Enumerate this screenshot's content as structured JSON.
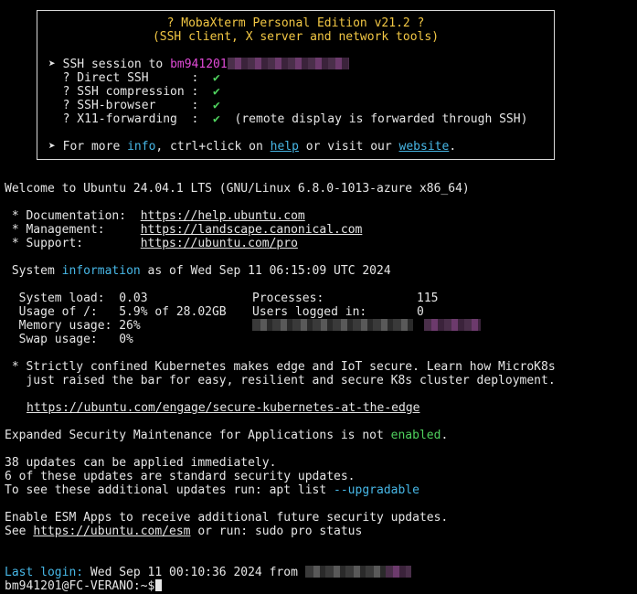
{
  "banner": {
    "title": "? MobaXterm Personal Edition v21.2 ?",
    "subtitle": "(SSH client, X server and network tools)",
    "session_prefix": "➤ SSH session to ",
    "session_user": "bm941201",
    "options": [
      {
        "label": "  ? Direct SSH      :",
        "check": "✔",
        "note": ""
      },
      {
        "label": "  ? SSH compression :",
        "check": "✔",
        "note": ""
      },
      {
        "label": "  ? SSH-browser     :",
        "check": "✔",
        "note": ""
      },
      {
        "label": "  ? X11-forwarding  :",
        "check": "✔",
        "note": "  (remote display is forwarded through SSH)"
      }
    ],
    "more_prefix": "➤ For more ",
    "more_info": "info",
    "more_mid": ", ctrl+click on ",
    "more_help": "help",
    "more_mid2": " or visit our ",
    "more_website": "website",
    "more_end": "."
  },
  "welcome": "Welcome to Ubuntu 24.04.1 LTS (GNU/Linux 6.8.0-1013-azure x86_64)",
  "docs": [
    {
      "label": " * Documentation:  ",
      "url": "https://help.ubuntu.com"
    },
    {
      "label": " * Management:     ",
      "url": "https://landscape.canonical.com"
    },
    {
      "label": " * Support:        ",
      "url": "https://ubuntu.com/pro"
    }
  ],
  "sysinfo": {
    "prefix": " System ",
    "word": "information",
    "suffix": " as of Wed Sep 11 06:15:09 UTC 2024"
  },
  "stats_left": [
    "  System load:  0.03",
    "  Usage of /:   5.9% of 28.02GB",
    "  Memory usage: 26%",
    "  Swap usage:   0%"
  ],
  "stats_right": [
    "Processes:             115",
    "Users logged in:       0"
  ],
  "k8s": [
    " * Strictly confined Kubernetes makes edge and IoT secure. Learn how MicroK8s",
    "   just raised the bar for easy, resilient and secure K8s cluster deployment."
  ],
  "k8s_url": "https://ubuntu.com/engage/secure-kubernetes-at-the-edge",
  "esm": {
    "prefix": "Expanded Security Maintenance for Applications is not ",
    "word": "enabled",
    "suffix": "."
  },
  "updates": [
    "38 updates can be applied immediately.",
    "6 of these updates are standard security updates."
  ],
  "updates_cmd": {
    "prefix": "To see these additional updates run: apt list ",
    "flag": "--upgradable"
  },
  "esm_apps": "Enable ESM Apps to receive additional future security updates.",
  "esm_see": {
    "prefix": "See ",
    "url": "https://ubuntu.com/esm",
    "suffix": " or run: sudo pro status"
  },
  "last_login": {
    "label": "Last login:",
    "text": " Wed Sep 11 00:10:36 2024 from "
  },
  "prompt": "bm941201@FC-VERANO:~$",
  "colors": {
    "title": "#f2c744",
    "magenta": "#e24bd8",
    "green": "#4fd15e",
    "cyan": "#47b7e6"
  }
}
